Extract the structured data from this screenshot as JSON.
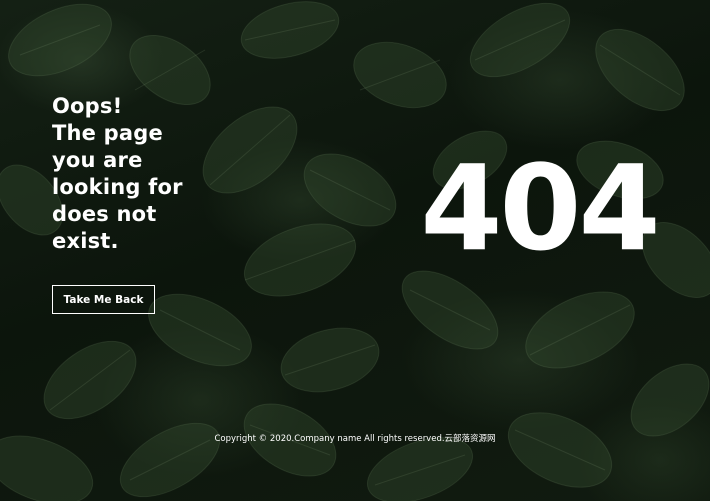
{
  "error": {
    "message": "Oops!\nThe page\nyou are\nlooking for\ndoes not\nexist.",
    "code": "404"
  },
  "actions": {
    "back_label": "Take Me Back"
  },
  "footer": {
    "copyright": "Copyright © 2020.Company name All rights reserved.云部落资源网"
  },
  "colors": {
    "text": "#ffffff",
    "background": "#0b120b",
    "leaf": "#30482c"
  }
}
